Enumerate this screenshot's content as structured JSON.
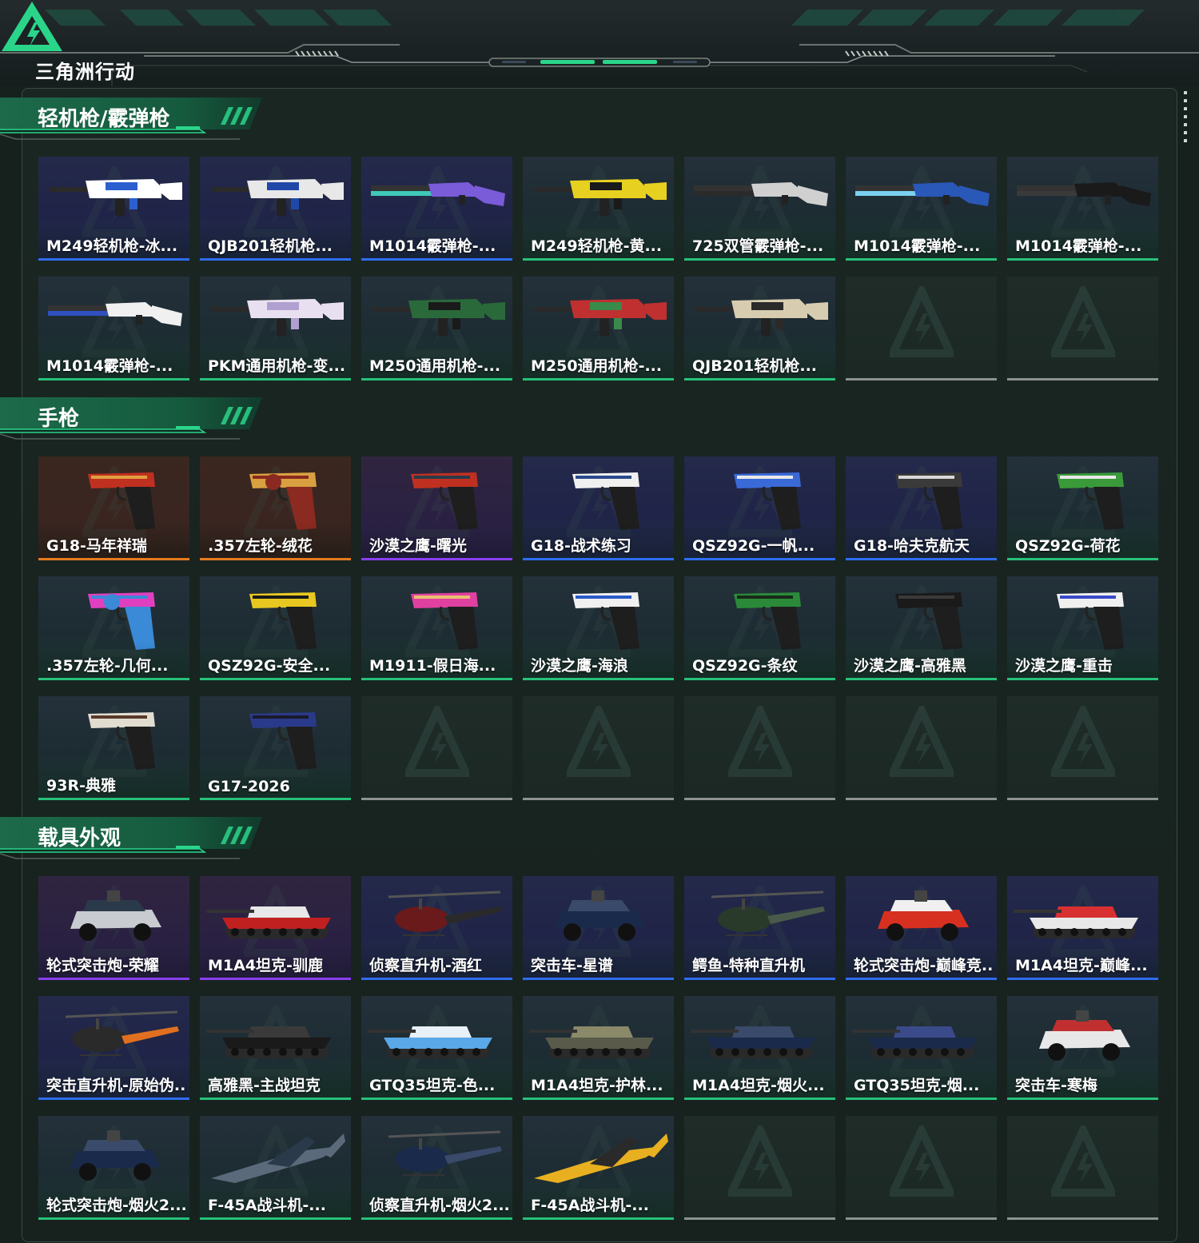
{
  "header": {
    "logo_text": "三角洲行动"
  },
  "sections": [
    {
      "title": "轻机枪/霰弹枪",
      "items": [
        {
          "name": "M249轻机枪-冰...",
          "rarity": "blue",
          "kind": "rifle",
          "colors": [
            "#ffffff",
            "#2b5fd0"
          ]
        },
        {
          "name": "QJB201轻机枪...",
          "rarity": "blue",
          "kind": "rifle",
          "colors": [
            "#e8e8e8",
            "#2048a8"
          ]
        },
        {
          "name": "M1014霰弹枪-...",
          "rarity": "blue",
          "kind": "shotgun",
          "colors": [
            "#7a5bd8",
            "#3fc8b8"
          ]
        },
        {
          "name": "M249轻机枪-黄...",
          "rarity": "green",
          "kind": "rifle",
          "colors": [
            "#e8d020",
            "#1a1a1a"
          ]
        },
        {
          "name": "725双管霰弹枪-...",
          "rarity": "green",
          "kind": "shotgun",
          "colors": [
            "#d0d0d0",
            "#2a2a2a"
          ]
        },
        {
          "name": "M1014霰弹枪-...",
          "rarity": "green",
          "kind": "shotgun",
          "colors": [
            "#2a58b8",
            "#7ad0f0"
          ]
        },
        {
          "name": "M1014霰弹枪-...",
          "rarity": "green",
          "kind": "shotgun",
          "colors": [
            "#1a1a1a",
            "#3a3a3a"
          ]
        },
        {
          "name": "M1014霰弹枪-...",
          "rarity": "green",
          "kind": "shotgun",
          "colors": [
            "#f0f0f0",
            "#3050c0"
          ]
        },
        {
          "name": "PKM通用机枪-变...",
          "rarity": "green",
          "kind": "rifle",
          "colors": [
            "#e8e0f0",
            "#b0a0d0"
          ]
        },
        {
          "name": "M250通用机枪-...",
          "rarity": "green",
          "kind": "rifle",
          "colors": [
            "#2a6a3a",
            "#1a1a1a"
          ]
        },
        {
          "name": "M250通用机枪-...",
          "rarity": "green",
          "kind": "rifle",
          "colors": [
            "#c03030",
            "#3a8a4a"
          ]
        },
        {
          "name": "QJB201轻机枪...",
          "rarity": "green",
          "kind": "rifle",
          "colors": [
            "#d8ccb0",
            "#2a2a2a"
          ]
        },
        {
          "name": "",
          "rarity": "empty",
          "kind": "none",
          "colors": []
        },
        {
          "name": "",
          "rarity": "empty",
          "kind": "none",
          "colors": []
        }
      ]
    },
    {
      "title": "手枪",
      "items": [
        {
          "name": "G18-马年祥瑞",
          "rarity": "orange",
          "kind": "pistol",
          "colors": [
            "#c03020",
            "#e0a040"
          ]
        },
        {
          "name": ".357左轮-绒花",
          "rarity": "orange",
          "kind": "revolver",
          "colors": [
            "#d8a040",
            "#8a2a20"
          ]
        },
        {
          "name": "沙漠之鹰-曙光",
          "rarity": "purple",
          "kind": "pistol",
          "colors": [
            "#c03020",
            "#2a3a4a"
          ]
        },
        {
          "name": "G18-战术练习",
          "rarity": "blue",
          "kind": "pistol",
          "colors": [
            "#f0f0f0",
            "#2a4a8a"
          ]
        },
        {
          "name": "QSZ92G-一帆...",
          "rarity": "blue",
          "kind": "pistol",
          "colors": [
            "#3a6ad8",
            "#e8e8e8"
          ]
        },
        {
          "name": "G18-哈夫克航天",
          "rarity": "blue",
          "kind": "pistol",
          "colors": [
            "#3a3a3a",
            "#d8d8d8"
          ]
        },
        {
          "name": "QSZ92G-荷花",
          "rarity": "green",
          "kind": "pistol",
          "colors": [
            "#3a9a3a",
            "#e8e8e8"
          ]
        },
        {
          "name": ".357左轮-几何...",
          "rarity": "green",
          "kind": "revolver",
          "colors": [
            "#e040c0",
            "#3a8ad8"
          ]
        },
        {
          "name": "QSZ92G-安全...",
          "rarity": "green",
          "kind": "pistol",
          "colors": [
            "#e8c820",
            "#1a1a1a"
          ]
        },
        {
          "name": "M1911-假日海...",
          "rarity": "green",
          "kind": "pistol",
          "colors": [
            "#e040a0",
            "#e8c070"
          ]
        },
        {
          "name": "沙漠之鹰-海浪",
          "rarity": "green",
          "kind": "pistol",
          "colors": [
            "#f0f0f0",
            "#2a5ac8"
          ]
        },
        {
          "name": "QSZ92G-条纹",
          "rarity": "green",
          "kind": "pistol",
          "colors": [
            "#2a8a3a",
            "#1a2a1a"
          ]
        },
        {
          "name": "沙漠之鹰-高雅黑",
          "rarity": "green",
          "kind": "pistol",
          "colors": [
            "#1a1a1a",
            "#3a3a3a"
          ]
        },
        {
          "name": "沙漠之鹰-重击",
          "rarity": "green",
          "kind": "pistol",
          "colors": [
            "#f0f0f0",
            "#3a4ac8"
          ]
        },
        {
          "name": "93R-典雅",
          "rarity": "green",
          "kind": "pistol",
          "colors": [
            "#e0dcd0",
            "#5a3a2a"
          ]
        },
        {
          "name": "G17-2026",
          "rarity": "green",
          "kind": "pistol",
          "colors": [
            "#2a3a8a",
            "#1a1a2a"
          ]
        },
        {
          "name": "",
          "rarity": "empty",
          "kind": "none",
          "colors": []
        },
        {
          "name": "",
          "rarity": "empty",
          "kind": "none",
          "colors": []
        },
        {
          "name": "",
          "rarity": "empty",
          "kind": "none",
          "colors": []
        },
        {
          "name": "",
          "rarity": "empty",
          "kind": "none",
          "colors": []
        },
        {
          "name": "",
          "rarity": "empty",
          "kind": "none",
          "colors": []
        }
      ]
    },
    {
      "title": "载具外观",
      "items": [
        {
          "name": "轮式突击炮-荣耀",
          "rarity": "purple",
          "kind": "car",
          "colors": [
            "#c8ccd0",
            "#2a3a4a"
          ]
        },
        {
          "name": "M1A4坦克-驯鹿",
          "rarity": "purple",
          "kind": "tank",
          "colors": [
            "#c02020",
            "#e8e8e8"
          ]
        },
        {
          "name": "侦察直升机-酒红",
          "rarity": "blue",
          "kind": "heli",
          "colors": [
            "#6a1a1a",
            "#2a2a2a"
          ]
        },
        {
          "name": "突击车-星谱",
          "rarity": "blue",
          "kind": "car",
          "colors": [
            "#1a2a4a",
            "#3a4a6a"
          ]
        },
        {
          "name": "鳄鱼-特种直升机",
          "rarity": "blue",
          "kind": "heli",
          "colors": [
            "#2a3a2a",
            "#4a5a4a"
          ]
        },
        {
          "name": "轮式突击炮-巅峰竞...",
          "rarity": "blue",
          "kind": "car",
          "colors": [
            "#d83020",
            "#f0f0f0"
          ]
        },
        {
          "name": "M1A4坦克-巅峰...",
          "rarity": "blue",
          "kind": "tank",
          "colors": [
            "#e8e8e8",
            "#d83030"
          ]
        },
        {
          "name": "突击直升机-原始伪...",
          "rarity": "blue",
          "kind": "heli",
          "colors": [
            "#2a2a2a",
            "#e07020"
          ]
        },
        {
          "name": "高雅黑-主战坦克",
          "rarity": "green",
          "kind": "tank",
          "colors": [
            "#1a1a1a",
            "#3a3a3a"
          ]
        },
        {
          "name": "GTQ35坦克-色...",
          "rarity": "green",
          "kind": "tank",
          "colors": [
            "#5aa8e8",
            "#e8f0f8"
          ]
        },
        {
          "name": "M1A4坦克-护林...",
          "rarity": "green",
          "kind": "tank",
          "colors": [
            "#5a5a4a",
            "#8a8a6a"
          ]
        },
        {
          "name": "M1A4坦克-烟火...",
          "rarity": "green",
          "kind": "tank",
          "colors": [
            "#1a2a4a",
            "#3a4a6a"
          ]
        },
        {
          "name": "GTQ35坦克-烟...",
          "rarity": "green",
          "kind": "tank",
          "colors": [
            "#1a2a4a",
            "#3a4a8a"
          ]
        },
        {
          "name": "突击车-寒梅",
          "rarity": "green",
          "kind": "car",
          "colors": [
            "#e8e8e8",
            "#c03030"
          ]
        },
        {
          "name": "轮式突击炮-烟火2...",
          "rarity": "green",
          "kind": "car",
          "colors": [
            "#1a2a4a",
            "#3a4a6a"
          ]
        },
        {
          "name": "F-45A战斗机-...",
          "rarity": "green",
          "kind": "jet",
          "colors": [
            "#5a6a7a",
            "#2a3a4a"
          ]
        },
        {
          "name": "侦察直升机-烟火2...",
          "rarity": "green",
          "kind": "heli",
          "colors": [
            "#1a2a4a",
            "#3a4a6a"
          ]
        },
        {
          "name": "F-45A战斗机-...",
          "rarity": "green",
          "kind": "jet",
          "colors": [
            "#e8b020",
            "#2a2a2a"
          ]
        },
        {
          "name": "",
          "rarity": "empty",
          "kind": "none",
          "colors": []
        },
        {
          "name": "",
          "rarity": "empty",
          "kind": "none",
          "colors": []
        },
        {
          "name": "",
          "rarity": "empty",
          "kind": "none",
          "colors": []
        }
      ]
    }
  ],
  "colors": {
    "rarity_green": "#27c17a",
    "rarity_blue": "#2f6df0",
    "rarity_purple": "#8a3ff0",
    "rarity_orange": "#e67a1e",
    "accent_green": "#2ad58a"
  }
}
